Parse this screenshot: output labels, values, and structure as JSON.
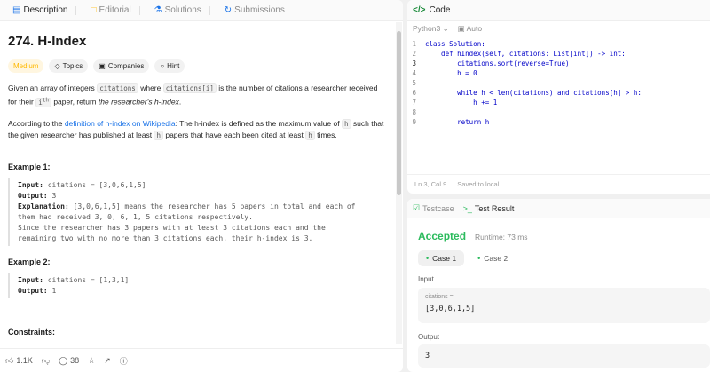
{
  "left_tabs": [
    {
      "label": "Description",
      "icon": "description-icon"
    },
    {
      "label": "Editorial",
      "icon": "editorial-icon"
    },
    {
      "label": "Solutions",
      "icon": "flask-icon"
    },
    {
      "label": "Submissions",
      "icon": "history-icon"
    }
  ],
  "problem": {
    "title": "274. H-Index",
    "difficulty": "Medium",
    "chips": [
      "Topics",
      "Companies",
      "Hint"
    ],
    "desc_1": "Given an array of integers",
    "code_citations": "citations",
    "desc_2": "where",
    "code_citations_i": "citations[i]",
    "desc_3": "is the number of citations a researcher received for their",
    "ith": "i",
    "ith_sup": "th",
    "desc_4": "paper, return",
    "desc_em": "the researcher's h-index",
    "desc_end": ".",
    "according_1": "According to the",
    "link_text": "definition of h-index on Wikipedia",
    "according_2": ": The h-index is defined as the maximum value of",
    "code_h": "h",
    "according_3": "such that the given researcher has published at least",
    "according_4": "papers that have each been cited at least",
    "according_5": "times.",
    "example1_title": "Example 1:",
    "example1_input_label": "Input:",
    "example1_input": " citations = [3,0,6,1,5]",
    "example1_output_label": "Output:",
    "example1_output": " 3",
    "example1_expl_label": "Explanation:",
    "example1_expl": " [3,0,6,1,5] means the researcher has 5 papers in total and each of\nthem had received 3, 0, 6, 1, 5 citations respectively.\nSince the researcher has 3 papers with at least 3 citations each and the\nremaining two with no more than 3 citations each, their h-index is 3.",
    "example2_title": "Example 2:",
    "example2_input_label": "Input:",
    "example2_input": " citations = [1,3,1]",
    "example2_output_label": "Output:",
    "example2_output": " 1",
    "constraints_title": "Constraints:"
  },
  "bottom_bar": {
    "likes": "1.1K",
    "comments": "38"
  },
  "editor": {
    "title": "Code",
    "language": "Python3",
    "auto": "Auto",
    "lines": [
      {
        "n": "1",
        "code": "class Solution:"
      },
      {
        "n": "2",
        "code": "    def hIndex(self, citations: List[int]) -> int:"
      },
      {
        "n": "3",
        "code": "        citations.sort(reverse=True)"
      },
      {
        "n": "4",
        "code": "        h = 0"
      },
      {
        "n": "5",
        "code": ""
      },
      {
        "n": "6",
        "code": "        while h < len(citations) and citations[h] > h:"
      },
      {
        "n": "7",
        "code": "            h += 1"
      },
      {
        "n": "8",
        "code": ""
      },
      {
        "n": "9",
        "code": "        return h"
      }
    ],
    "status_pos": "Ln 3, Col 9",
    "status_saved": "Saved to local"
  },
  "result": {
    "tab_testcase": "Testcase",
    "tab_result": "Test Result",
    "status": "Accepted",
    "runtime": "Runtime: 73 ms",
    "case1": "Case 1",
    "case2": "Case 2",
    "input_label": "Input",
    "input_var": "citations =",
    "input_value": "[3,0,6,1,5]",
    "output_label": "Output",
    "output_value": "3"
  },
  "colors": {
    "accent_green": "#2cbb5d",
    "medium": "#ffb800",
    "link": "#1a73e8"
  }
}
